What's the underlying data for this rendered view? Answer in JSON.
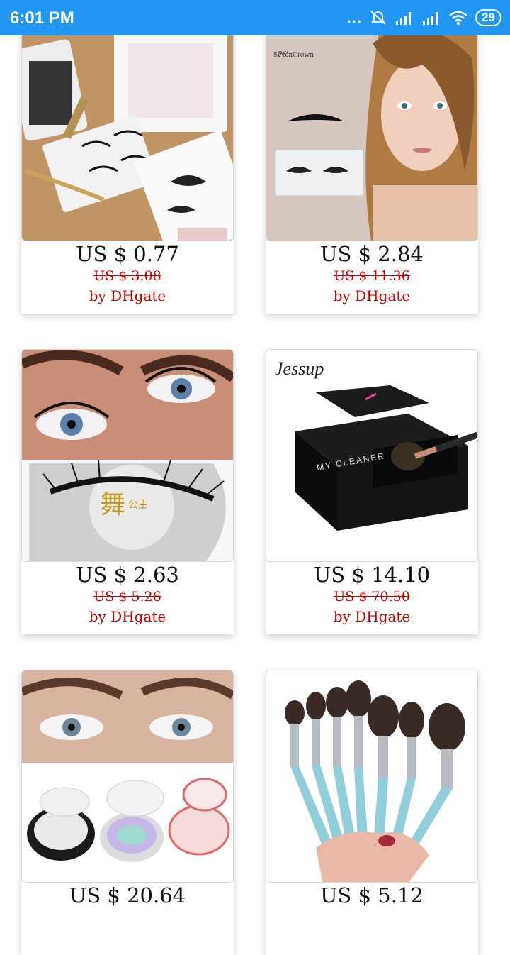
{
  "status_bar": {
    "time": "6:01 PM",
    "dots": "...",
    "battery": "29"
  },
  "colors": {
    "status_bar": "#2196F3",
    "price": "#111111",
    "discount": "#cc0000"
  },
  "products": [
    {
      "price": "US $ 0.77",
      "old_price": "US $ 3.08",
      "seller": "by DHgate",
      "image": "magnetic-eyeliner-lash-kit",
      "brand_text": ""
    },
    {
      "price": "US $ 2.84",
      "old_price": "US $ 11.36",
      "seller": "by DHgate",
      "image": "sevencrown-lashes-model",
      "brand_text": "SevenCrown"
    },
    {
      "price": "US $ 2.63",
      "old_price": "US $ 5.26",
      "seller": "by DHgate",
      "image": "mink-lashes-eye-closeup",
      "brand_text": "公主"
    },
    {
      "price": "US $ 14.10",
      "old_price": "US $ 70.50",
      "seller": "by DHgate",
      "image": "jessup-my-cleaner-box",
      "brand_text": "Jessup",
      "box_text": "MY CLEANER"
    },
    {
      "price": "US $ 20.64",
      "old_price": "",
      "seller": "",
      "image": "lashes-in-round-cases",
      "brand_text": ""
    },
    {
      "price": "US $ 5.12",
      "old_price": "",
      "seller": "",
      "image": "crystal-makeup-brush-set",
      "brand_text": ""
    }
  ]
}
